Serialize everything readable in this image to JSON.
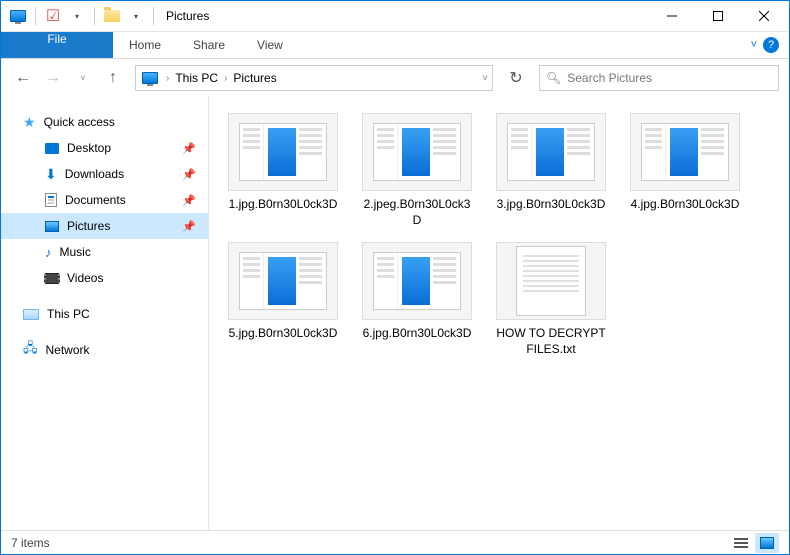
{
  "titlebar": {
    "title": "Pictures"
  },
  "ribbon": {
    "file": "File",
    "home": "Home",
    "share": "Share",
    "view": "View"
  },
  "breadcrumb": {
    "root": "This PC",
    "folder": "Pictures"
  },
  "search": {
    "placeholder": "Search Pictures"
  },
  "sidebar": {
    "quick_access": "Quick access",
    "desktop": "Desktop",
    "downloads": "Downloads",
    "documents": "Documents",
    "pictures": "Pictures",
    "music": "Music",
    "videos": "Videos",
    "this_pc": "This PC",
    "network": "Network"
  },
  "files": [
    {
      "name": "1.jpg.B0rn30L0ck3D",
      "type": "img"
    },
    {
      "name": "2.jpeg.B0rn30L0ck3D",
      "type": "img"
    },
    {
      "name": "3.jpg.B0rn30L0ck3D",
      "type": "img"
    },
    {
      "name": "4.jpg.B0rn30L0ck3D",
      "type": "img"
    },
    {
      "name": "5.jpg.B0rn30L0ck3D",
      "type": "img"
    },
    {
      "name": "6.jpg.B0rn30L0ck3D",
      "type": "img"
    },
    {
      "name": "HOW TO DECRYPT FILES.txt",
      "type": "txt"
    }
  ],
  "statusbar": {
    "count": "7 items"
  }
}
